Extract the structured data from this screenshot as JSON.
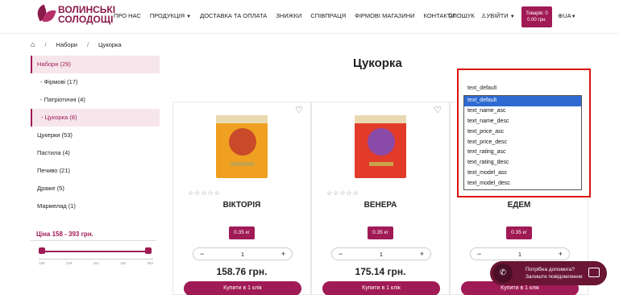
{
  "header": {
    "logo_line1": "ВОЛИНСЬКІ",
    "logo_line2": "СОЛОДОЩІ",
    "nav": [
      "ПРО НАС",
      "ПРОДУКЦІЯ",
      "ДОСТАВКА ТА ОПЛАТА",
      "ЗНИЖКИ",
      "СПІВПРАЦЯ",
      "ФІРМОВІ МАГАЗИНИ",
      "КОНТАКТИ"
    ],
    "search_label": "ПОШУК",
    "login_label": "УВІЙТИ",
    "cart_line1": "Товарів: 0",
    "cart_line2": "0.00 грн.",
    "lang": "UA"
  },
  "breadcrumb": [
    "Набори",
    "Цукорка"
  ],
  "sidebar": {
    "items": [
      {
        "label": "Набори (29)",
        "active": true,
        "sub": false
      },
      {
        "label": "- Фірмові (17)",
        "active": false,
        "sub": true
      },
      {
        "label": "- Патріотичні (4)",
        "active": false,
        "sub": true
      },
      {
        "label": "- Цукорка (8)",
        "active": true,
        "sub": true
      },
      {
        "label": "Цукерки (53)",
        "active": false,
        "sub": false
      },
      {
        "label": "Пастила (4)",
        "active": false,
        "sub": false
      },
      {
        "label": "Печиво (21)",
        "active": false,
        "sub": false
      },
      {
        "label": "Драже (5)",
        "active": false,
        "sub": false
      },
      {
        "label": "Мармелад (1)",
        "active": false,
        "sub": false
      }
    ],
    "price_label": "Ціна  158 - 393 грн.",
    "ticks": [
      "158",
      "109",
      "164",
      "182",
      "393"
    ]
  },
  "page_title": "Цукорка",
  "sort": {
    "selected": "text_default",
    "options": [
      "text_default",
      "text_name_asc",
      "text_name_desc",
      "text_price_asc",
      "text_price_desc",
      "text_rating_asc",
      "text_rating_desc",
      "text_model_asc",
      "text_model_desc"
    ]
  },
  "products": [
    {
      "name": "ВІКТОРІЯ",
      "weight": "0.35 кг",
      "qty": "1",
      "price": "158.76 грн.",
      "buy": "Купити в 1 клік",
      "stars": "☆☆☆☆☆",
      "box_color": "#f0a020",
      "flower_color": "#c84a2a"
    },
    {
      "name": "ВЕНЕРА",
      "weight": "0.35 кг",
      "qty": "1",
      "price": "175.14 грн.",
      "buy": "Купити в 1 клік",
      "stars": "☆☆☆☆☆",
      "box_color": "#e23b2a",
      "flower_color": "#8a4aa8"
    },
    {
      "name": "ЕДЕМ",
      "weight": "0.35 кг",
      "qty": "1",
      "price": "",
      "buy": "Купити в 1 клік",
      "stars": "☆☆☆☆☆",
      "box_color": "#eee",
      "flower_color": "#ccc"
    }
  ],
  "help": {
    "line1": "Потрібна допомога?",
    "line2": "Залиште повідомлення"
  },
  "colors": {
    "brand": "#a01a55",
    "highlight": "#2e6ad1"
  }
}
